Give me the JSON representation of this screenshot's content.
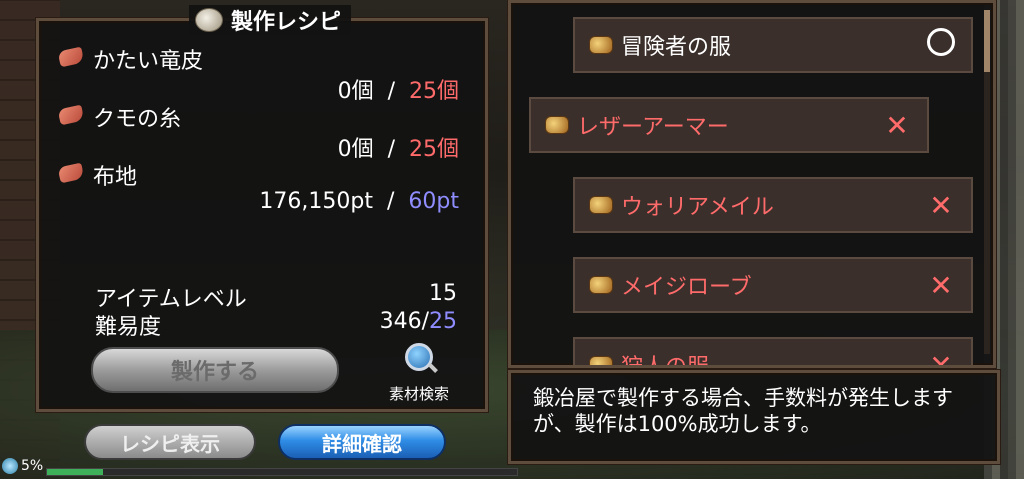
{
  "recipe": {
    "title": "製作レシピ",
    "materials": [
      {
        "name": "かたい竜皮",
        "have": "0個",
        "slash": "/",
        "need": "25個"
      },
      {
        "name": "クモの糸",
        "have": "0個",
        "slash": "/",
        "need": "25個"
      },
      {
        "name": "布地",
        "have": "176,150pt",
        "slash": "/",
        "need": "60pt"
      }
    ],
    "item_level_label": "アイテムレベル",
    "item_level_value": "15",
    "difficulty_label": "難易度",
    "difficulty_value": "346/",
    "difficulty_req": "25",
    "craft_button": "製作する",
    "search_label": "素材検索"
  },
  "buttons": {
    "show_recipe": "レシピ表示",
    "detail_confirm": "詳細確認"
  },
  "status": {
    "level": "5%",
    "xp_fraction": 0.12
  },
  "list": {
    "items": [
      {
        "name": "冒険者の服",
        "status": "ok"
      },
      {
        "name": "レザーアーマー",
        "status": "ng",
        "mark": "✕"
      },
      {
        "name": "ウォリアメイル",
        "status": "ng",
        "mark": "✕"
      },
      {
        "name": "メイジローブ",
        "status": "ng",
        "mark": "✕"
      },
      {
        "name": "狩人の服",
        "status": "ng",
        "mark": "✕"
      }
    ]
  },
  "info": {
    "message": "鍛冶屋で製作する場合、手数料が発生しますが、製作は100%成功します。"
  },
  "colors": {
    "required_red": "#ff6b6b",
    "required_blue": "#8f8dff",
    "accent_blue": "#2f8de6"
  }
}
